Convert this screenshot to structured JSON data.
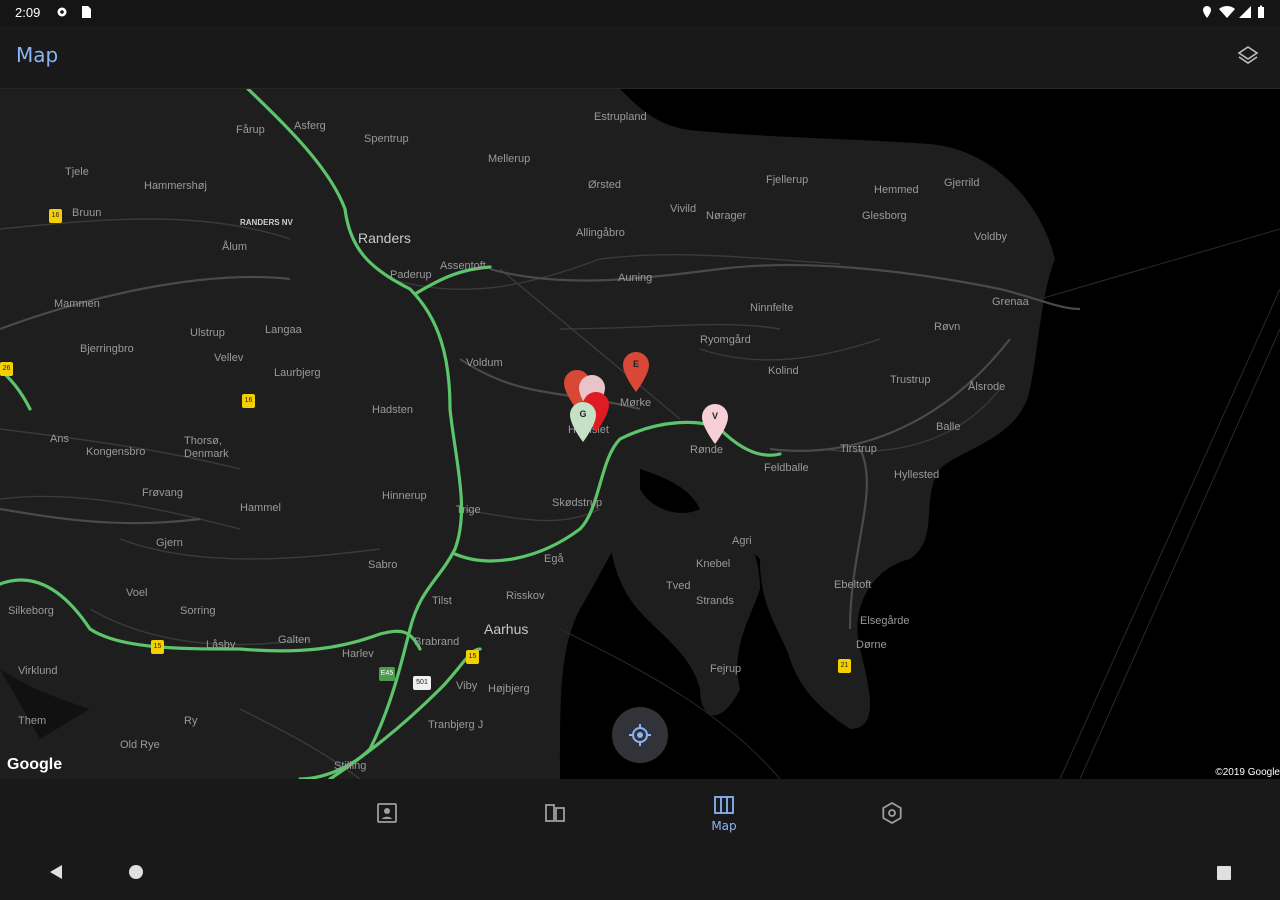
{
  "status_bar": {
    "time": "2:09"
  },
  "app_bar": {
    "title": "Map",
    "layers_icon": "layers-icon"
  },
  "map": {
    "places": [
      {
        "id": "randers",
        "label": "Randers",
        "size": "big"
      },
      {
        "id": "aarhus",
        "label": "Aarhus",
        "size": "big"
      },
      {
        "id": "silkeborg",
        "label": "Silkeborg",
        "size": "normal"
      },
      {
        "id": "estrupland",
        "label": "Estrupland",
        "size": "normal"
      },
      {
        "id": "asferg",
        "label": "Asferg",
        "size": "normal"
      },
      {
        "id": "farup",
        "label": "Fårup",
        "size": "normal"
      },
      {
        "id": "spentrup",
        "label": "Spentrup",
        "size": "normal"
      },
      {
        "id": "mellerup",
        "label": "Mellerup",
        "size": "normal"
      },
      {
        "id": "orsted",
        "label": "Ørsted",
        "size": "normal"
      },
      {
        "id": "fjellerup",
        "label": "Fjellerup",
        "size": "normal"
      },
      {
        "id": "hemmed",
        "label": "Hemmed",
        "size": "normal"
      },
      {
        "id": "gjerrild",
        "label": "Gjerrild",
        "size": "normal"
      },
      {
        "id": "tjele",
        "label": "Tjele",
        "size": "normal"
      },
      {
        "id": "hammershoj",
        "label": "Hammershøj",
        "size": "normal"
      },
      {
        "id": "vivild",
        "label": "Vivild",
        "size": "normal"
      },
      {
        "id": "norager",
        "label": "Nørager",
        "size": "normal"
      },
      {
        "id": "glesborg",
        "label": "Glesborg",
        "size": "normal"
      },
      {
        "id": "bruun",
        "label": "Bruun",
        "size": "normal"
      },
      {
        "id": "randersnv",
        "label": "RANDERS NV",
        "size": "tiny"
      },
      {
        "id": "allingabro",
        "label": "Allingåbro",
        "size": "normal"
      },
      {
        "id": "voldby",
        "label": "Voldby",
        "size": "normal"
      },
      {
        "id": "alum",
        "label": "Ålum",
        "size": "normal"
      },
      {
        "id": "paderup",
        "label": "Paderup",
        "size": "normal"
      },
      {
        "id": "assentoft",
        "label": "Assentoft",
        "size": "normal"
      },
      {
        "id": "auning",
        "label": "Auning",
        "size": "normal"
      },
      {
        "id": "grenaa",
        "label": "Grenaa",
        "size": "normal"
      },
      {
        "id": "mammen",
        "label": "Mammen",
        "size": "normal"
      },
      {
        "id": "ninnfelte",
        "label": "Ninnfelte",
        "size": "normal"
      },
      {
        "id": "ulstrup",
        "label": "Ulstrup",
        "size": "normal"
      },
      {
        "id": "langaa",
        "label": "Langaa",
        "size": "normal"
      },
      {
        "id": "rovn",
        "label": "Røvn",
        "size": "normal"
      },
      {
        "id": "ryomgard",
        "label": "Ryomgård",
        "size": "normal"
      },
      {
        "id": "bjerringbro",
        "label": "Bjerringbro",
        "size": "normal"
      },
      {
        "id": "vellev",
        "label": "Vellev",
        "size": "normal"
      },
      {
        "id": "voldum",
        "label": "Voldum",
        "size": "normal"
      },
      {
        "id": "kolind",
        "label": "Kolind",
        "size": "normal"
      },
      {
        "id": "trustrup",
        "label": "Trustrup",
        "size": "normal"
      },
      {
        "id": "laurbjerg",
        "label": "Laurbjerg",
        "size": "normal"
      },
      {
        "id": "morke",
        "label": "Mørke",
        "size": "normal"
      },
      {
        "id": "alsrode",
        "label": "Ålsrode",
        "size": "normal"
      },
      {
        "id": "hadsten",
        "label": "Hadsten",
        "size": "normal"
      },
      {
        "id": "ans",
        "label": "Ans",
        "size": "normal"
      },
      {
        "id": "thorso",
        "label": "Thorsø,\nDenmark",
        "size": "normal"
      },
      {
        "id": "hornslet",
        "label": "Hornslet",
        "size": "normal"
      },
      {
        "id": "balle",
        "label": "Balle",
        "size": "normal"
      },
      {
        "id": "kongensbro",
        "label": "Kongensbro",
        "size": "normal"
      },
      {
        "id": "ronde",
        "label": "Rønde",
        "size": "normal"
      },
      {
        "id": "tirstrup",
        "label": "Tirstrup",
        "size": "normal"
      },
      {
        "id": "feldballe",
        "label": "Feldballe",
        "size": "normal"
      },
      {
        "id": "hyllested",
        "label": "Hyllested",
        "size": "normal"
      },
      {
        "id": "frovang",
        "label": "Frøvang",
        "size": "normal"
      },
      {
        "id": "hinnerup",
        "label": "Hinnerup",
        "size": "normal"
      },
      {
        "id": "skodstrup",
        "label": "Skødstrup",
        "size": "normal"
      },
      {
        "id": "hammel",
        "label": "Hammel",
        "size": "normal"
      },
      {
        "id": "trige",
        "label": "Trige",
        "size": "normal"
      },
      {
        "id": "agri",
        "label": "Agri",
        "size": "normal"
      },
      {
        "id": "gjern",
        "label": "Gjern",
        "size": "normal"
      },
      {
        "id": "knebel",
        "label": "Knebel",
        "size": "normal"
      },
      {
        "id": "ega",
        "label": "Egå",
        "size": "normal"
      },
      {
        "id": "sabro",
        "label": "Sabro",
        "size": "normal"
      },
      {
        "id": "ebeltoft",
        "label": "Ebeltoft",
        "size": "normal"
      },
      {
        "id": "voel",
        "label": "Voel",
        "size": "normal"
      },
      {
        "id": "tved",
        "label": "Tved",
        "size": "normal"
      },
      {
        "id": "tilst",
        "label": "Tilst",
        "size": "normal"
      },
      {
        "id": "risskov",
        "label": "Risskov",
        "size": "normal"
      },
      {
        "id": "strands",
        "label": "Strands",
        "size": "normal"
      },
      {
        "id": "sorring",
        "label": "Sorring",
        "size": "normal"
      },
      {
        "id": "elsegarde",
        "label": "Elsegårde",
        "size": "normal"
      },
      {
        "id": "galten",
        "label": "Galten",
        "size": "normal"
      },
      {
        "id": "laasby",
        "label": "Låsby",
        "size": "normal"
      },
      {
        "id": "brabrand",
        "label": "Brabrand",
        "size": "normal"
      },
      {
        "id": "dorne",
        "label": "Dørne",
        "size": "normal"
      },
      {
        "id": "harlev",
        "label": "Harlev",
        "size": "normal"
      },
      {
        "id": "virklund",
        "label": "Virklund",
        "size": "normal"
      },
      {
        "id": "fejrup",
        "label": "Fejrup",
        "size": "normal"
      },
      {
        "id": "viby",
        "label": "Viby",
        "size": "normal"
      },
      {
        "id": "hojbjerg",
        "label": "Højbjerg",
        "size": "normal"
      },
      {
        "id": "them",
        "label": "Them",
        "size": "normal"
      },
      {
        "id": "ry",
        "label": "Ry",
        "size": "normal"
      },
      {
        "id": "tranbjerg",
        "label": "Tranbjerg J",
        "size": "normal"
      },
      {
        "id": "oldrye",
        "label": "Old Rye",
        "size": "normal"
      },
      {
        "id": "stilling",
        "label": "Stilling",
        "size": "normal"
      }
    ],
    "route_shields": [
      {
        "id": "r16a",
        "label": "16"
      },
      {
        "id": "r26a",
        "label": "26"
      },
      {
        "id": "r16b",
        "label": "16"
      },
      {
        "id": "r15",
        "label": "15"
      },
      {
        "id": "r21",
        "label": "21"
      },
      {
        "id": "r501",
        "label": "501"
      },
      {
        "id": "re45",
        "label": "E45"
      },
      {
        "id": "r15b",
        "label": "15"
      }
    ],
    "markers": [
      {
        "id": "e",
        "letter": "E",
        "color": "#d94836"
      },
      {
        "id": "x",
        "letter": "",
        "color": "#d94836"
      },
      {
        "id": "y",
        "letter": "",
        "color": "#e8c4c9"
      },
      {
        "id": "z",
        "letter": "",
        "color": "#e01b24"
      },
      {
        "id": "g",
        "letter": "G",
        "color": "#c6e2c6"
      },
      {
        "id": "v",
        "letter": "V",
        "color": "#f6d0d6"
      }
    ],
    "google_logo": "Google",
    "copyright": "©2019 Google",
    "locate_icon": "my-location-icon"
  },
  "bottom_nav": {
    "items": [
      {
        "id": "contacts",
        "icon": "contacts-icon",
        "label": ""
      },
      {
        "id": "pages",
        "icon": "pages-icon",
        "label": ""
      },
      {
        "id": "map",
        "icon": "map-icon",
        "label": "Map",
        "active": true
      },
      {
        "id": "settings",
        "icon": "settings-icon",
        "label": ""
      }
    ]
  },
  "colors": {
    "accent": "#8ab4f8",
    "road_major": "#5cc46a",
    "marker_red": "#d94836",
    "background": "#000000"
  }
}
